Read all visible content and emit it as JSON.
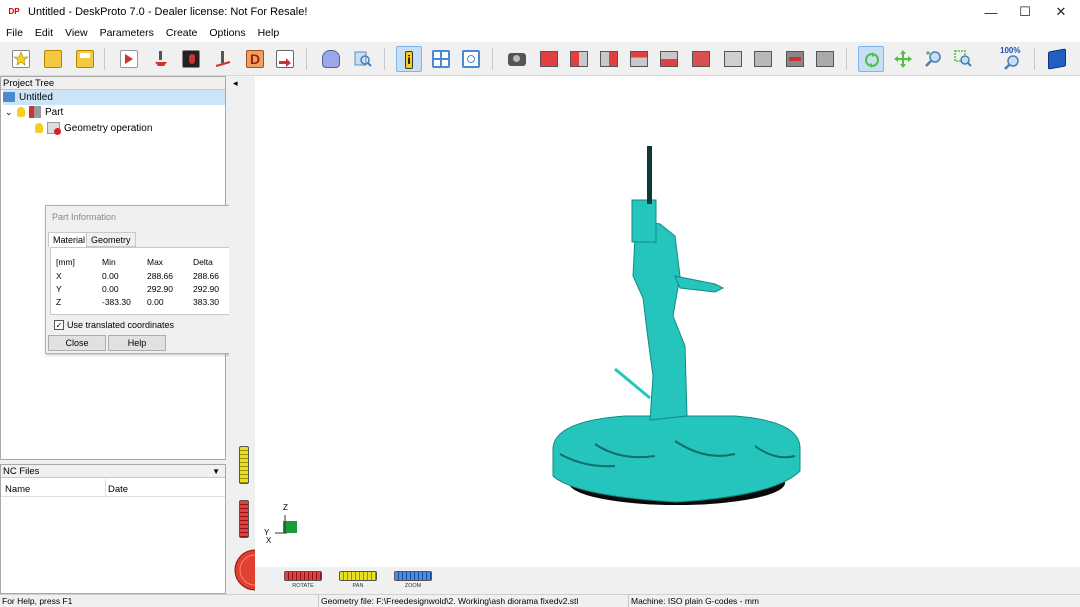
{
  "window": {
    "title": "Untitled - DeskProto 7.0 - Dealer license: Not For Resale!",
    "logo": "DP",
    "minimize_glyph": "—",
    "maximize_glyph": "☐",
    "close_glyph": "✕"
  },
  "menu": [
    "File",
    "Edit",
    "View",
    "Parameters",
    "Create",
    "Options",
    "Help"
  ],
  "toolbar": {
    "zoom_label": "100%",
    "icons": [
      "new-project-icon",
      "open-folder-icon",
      "save-icon",
      "import-geometry-icon",
      "toolpath-icon",
      "bitmap-icon",
      "vector-icon",
      "drawing-icon",
      "export-icon",
      "3d-view-icon",
      "preview-icon",
      "info-icon",
      "layout-icon",
      "nc-view-icon",
      "camera-icon",
      "view-cube-icons",
      "rotate-tool-icon",
      "pan-tool-icon",
      "zoom-tool-icon",
      "zoom-window-icon",
      "zoom-100-icon",
      "help-book-icon"
    ]
  },
  "project_tree": {
    "header": "Project Tree",
    "root": "Untitled",
    "part": "Part",
    "operation": "Geometry operation"
  },
  "part_info": {
    "title": "Part Information",
    "tabs": [
      "Material",
      "Geometry"
    ],
    "headers": [
      "[mm]",
      "Min",
      "Max",
      "Delta"
    ],
    "rows": [
      {
        "axis": "X",
        "min": "0.00",
        "max": "288.66",
        "delta": "288.66"
      },
      {
        "axis": "Y",
        "min": "0.00",
        "max": "292.90",
        "delta": "292.90"
      },
      {
        "axis": "Z",
        "min": "-383.30",
        "max": "0.00",
        "delta": "383.30"
      }
    ],
    "checkbox_label": "Use translated coordinates",
    "checkbox_mark": "✓",
    "close_label": "Close",
    "help_label": "Help"
  },
  "nc_files": {
    "header": "NC Files",
    "columns": [
      "Name",
      "Date"
    ]
  },
  "view": {
    "axis_z": "Z",
    "axis_y": "Y",
    "axis_x": "X",
    "collapse_arrow": "◂",
    "dropdown_arrow": "▼",
    "rotate_label": "ROTATE",
    "pan_label": "PAN",
    "zoom_label": "ZOOM",
    "model_color": "#25c4bc"
  },
  "status": {
    "help": "For Help, press F1",
    "geometry": "Geometry file: F:\\Freedesignwold\\2. Working\\ash diorama fixedv2.stl",
    "machine": "Machine: ISO plain G-codes - mm"
  }
}
